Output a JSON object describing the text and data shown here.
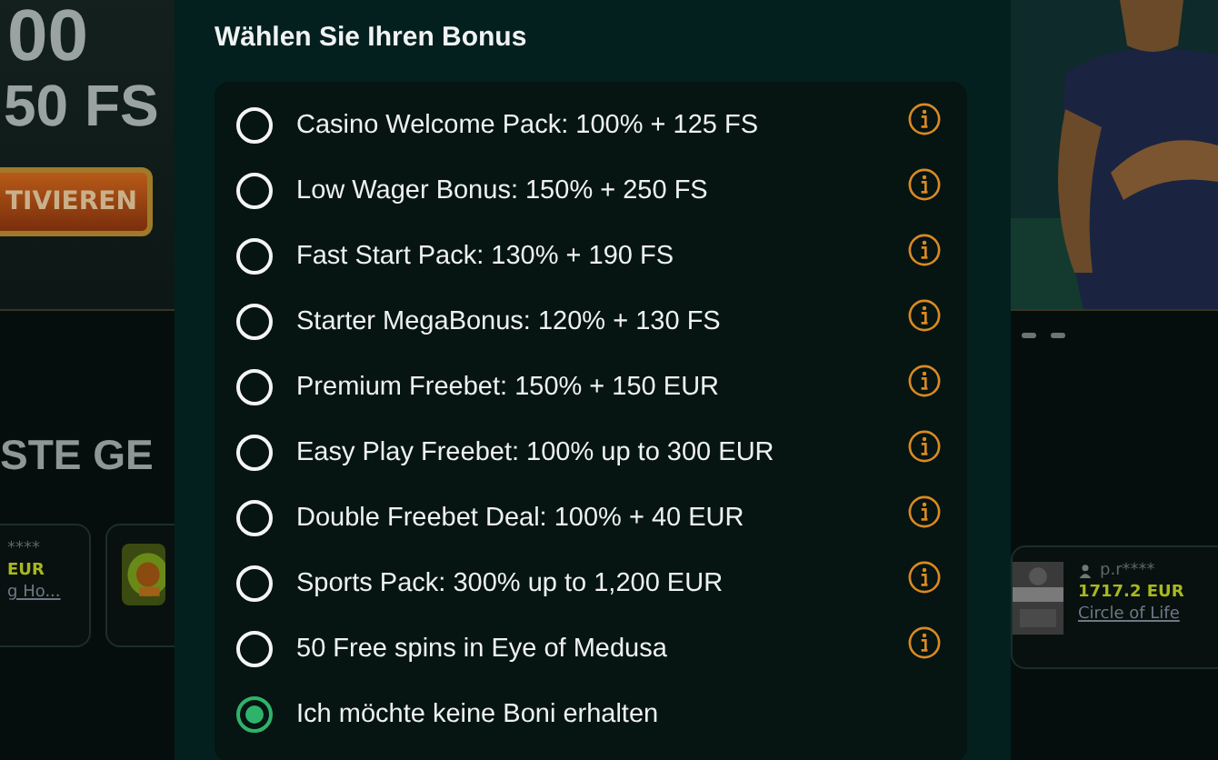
{
  "background": {
    "hero": {
      "headline": "00",
      "subline": "50 FS",
      "button": "TIVIEREN"
    },
    "section_heading": "STE GE",
    "left_card": {
      "user": "****",
      "amount": "EUR",
      "game": "g Ho..."
    },
    "right_card": {
      "user": "p.r****",
      "amount": "1717.2 EUR",
      "game": "Circle of Life"
    }
  },
  "modal": {
    "title": "Wählen Sie Ihren Bonus",
    "options": [
      {
        "label": "Casino Welcome Pack: 100% + 125 FS",
        "selected": false,
        "info": true
      },
      {
        "label": "Low Wager Bonus: 150% + 250 FS",
        "selected": false,
        "info": true
      },
      {
        "label": "Fast Start Pack: 130% + 190 FS",
        "selected": false,
        "info": true
      },
      {
        "label": "Starter MegaBonus: 120% + 130 FS",
        "selected": false,
        "info": true
      },
      {
        "label": "Premium Freebet: 150% + 150 EUR",
        "selected": false,
        "info": true
      },
      {
        "label": "Easy Play Freebet: 100% up to 300 EUR",
        "selected": false,
        "info": true
      },
      {
        "label": "Double Freebet Deal: 100% + 40 EUR",
        "selected": false,
        "info": true
      },
      {
        "label": "Sports Pack: 300% up to 1,200 EUR",
        "selected": false,
        "info": true
      },
      {
        "label": "50 Free spins in Eye of Medusa",
        "selected": false,
        "info": true
      },
      {
        "label": "Ich möchte keine Boni erhalten",
        "selected": true,
        "info": false
      }
    ]
  }
}
